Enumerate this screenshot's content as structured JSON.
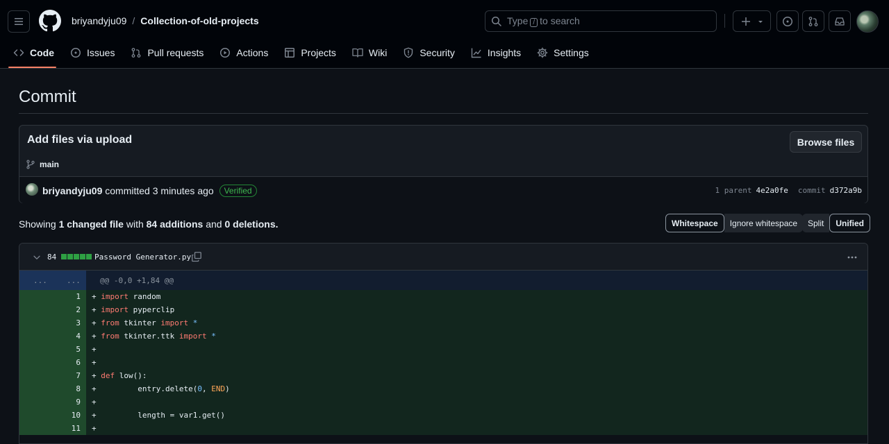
{
  "header": {
    "owner": "briyandyju09",
    "separator": "/",
    "repo": "Collection-of-old-projects",
    "search_prefix": "Type",
    "search_key": "/",
    "search_suffix": "to search"
  },
  "tabs": [
    {
      "label": "Code",
      "icon": "code-icon",
      "active": true
    },
    {
      "label": "Issues",
      "icon": "issue-icon"
    },
    {
      "label": "Pull requests",
      "icon": "pull-request-icon"
    },
    {
      "label": "Actions",
      "icon": "play-icon"
    },
    {
      "label": "Projects",
      "icon": "table-icon"
    },
    {
      "label": "Wiki",
      "icon": "book-icon"
    },
    {
      "label": "Security",
      "icon": "shield-icon"
    },
    {
      "label": "Insights",
      "icon": "graph-icon"
    },
    {
      "label": "Settings",
      "icon": "gear-icon"
    }
  ],
  "page": {
    "title": "Commit"
  },
  "commit": {
    "message": "Add files via upload",
    "browse_label": "Browse files",
    "branch": "main",
    "author": "briyandyju09",
    "action": "committed 3 minutes ago",
    "verified": "Verified",
    "parent_label": "1 parent",
    "parent_sha": "4e2a0fe",
    "commit_label": "commit",
    "commit_sha": "d372a9b"
  },
  "summary": {
    "showing": "Showing",
    "files": "1 changed file",
    "with": "with",
    "additions": "84 additions",
    "and": "and",
    "deletions": "0 deletions",
    "end": "."
  },
  "view_options": {
    "whitespace": "Whitespace",
    "ignore_whitespace": "Ignore whitespace",
    "split": "Split",
    "unified": "Unified"
  },
  "file": {
    "count": "84",
    "name": "Password Generator.py",
    "hunk_old": "...",
    "hunk_new": "...",
    "hunk_header": "@@ -0,0 +1,84 @@"
  },
  "diff_lines": [
    {
      "n": "1",
      "t": "+ import random"
    },
    {
      "n": "2",
      "t": "+ import pyperclip"
    },
    {
      "n": "3",
      "t": "+ from tkinter import *"
    },
    {
      "n": "4",
      "t": "+ from tkinter.ttk import *"
    },
    {
      "n": "5",
      "t": "+"
    },
    {
      "n": "6",
      "t": "+"
    },
    {
      "n": "7",
      "t": "+ def low():"
    },
    {
      "n": "8",
      "t": "+         entry.delete(0, END)"
    },
    {
      "n": "9",
      "t": "+"
    },
    {
      "n": "10",
      "t": "+         length = var1.get()"
    },
    {
      "n": "11",
      "t": "+"
    }
  ]
}
